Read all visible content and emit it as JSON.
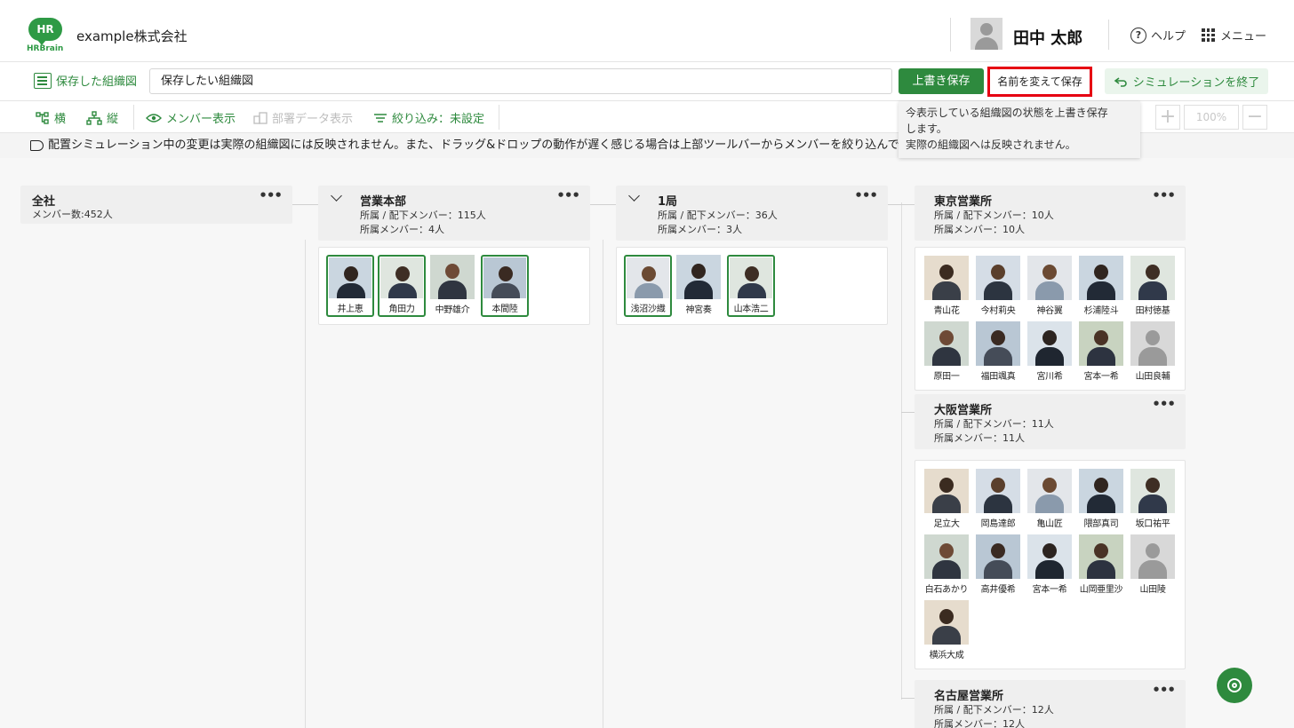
{
  "header": {
    "logo_text": "HR",
    "logo_sub": "HRBrain",
    "company": "example株式会社",
    "user_name": "田中 太郎",
    "help_label": "ヘルプ",
    "menu_label": "メニュー"
  },
  "toolbar1": {
    "saved_label": "保存した組織図",
    "name_value": "保存したい組織図",
    "overwrite_label": "上書き保存",
    "rename_label": "名前を変えて保存",
    "end_label": "シミュレーションを終了"
  },
  "toolbar2": {
    "horizontal": "横",
    "vertical": "縦",
    "show_members": "メンバー表示",
    "dept_data": "部署データ表示",
    "filter": "絞り込み：未設定",
    "zoom": "100%"
  },
  "tooltip": {
    "line1": "今表示している組織図の状態を上書き保存",
    "line2": "します。",
    "line3": "実際の組織図へは反映されません。"
  },
  "notice": "配置シミュレーション中の変更は実際の組織図には反映されません。また、ドラッグ&ドロップの動作が遅く感じる場合は上部ツールバーからメンバーを絞り込んでご利",
  "org": {
    "root": {
      "name": "全社",
      "line1": "メンバー数:452人"
    },
    "sales_hq": {
      "name": "営業本部",
      "line1": "所属 / 配下メンバー：115人",
      "line2": "所属メンバー：4人",
      "members": [
        "井上恵",
        "角田力",
        "中野雄介",
        "本間陸"
      ]
    },
    "bureau1": {
      "name": "1局",
      "line1": "所属 / 配下メンバー：36人",
      "line2": "所属メンバー：3人",
      "members": [
        "浅沼沙織",
        "神宮奏",
        "山本浩二"
      ]
    },
    "tokyo": {
      "name": "東京営業所",
      "line1": "所属 / 配下メンバー：10人",
      "line2": "所属メンバー：10人",
      "members": [
        "青山花",
        "今村莉央",
        "神谷翼",
        "杉浦陸斗",
        "田村徳基",
        "原田一",
        "福田颯真",
        "宮川希",
        "宮本一希",
        "山田良輔"
      ]
    },
    "osaka": {
      "name": "大阪営業所",
      "line1": "所属 / 配下メンバー：11人",
      "line2": "所属メンバー：11人",
      "members": [
        "足立大",
        "岡島達郎",
        "亀山匠",
        "隈部真司",
        "坂口祐平",
        "白石あかり",
        "高井優希",
        "宮本一希",
        "山岡亜里沙",
        "山田陵",
        "横浜大成"
      ]
    },
    "nagoya": {
      "name": "名古屋営業所",
      "line1": "所属 / 配下メンバー：12人",
      "line2": "所属メンバー：12人"
    }
  },
  "colors": {
    "brand": "#2e8a3e",
    "highlight": "#e60012"
  }
}
